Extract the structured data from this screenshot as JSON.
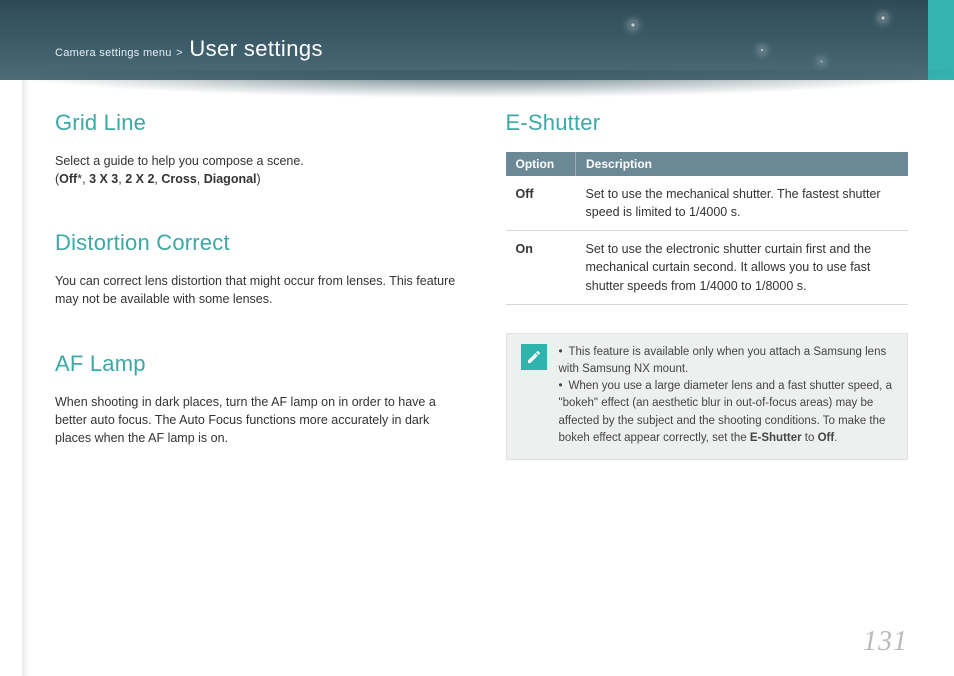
{
  "header": {
    "breadcrumb": "Camera settings menu",
    "separator": ">",
    "title": "User settings"
  },
  "left": {
    "grid": {
      "heading": "Grid Line",
      "text": "Select a guide to help you compose a scene.",
      "options_prefix": "(",
      "opt1": "Off",
      "star": "*",
      "sep": ", ",
      "opt2": "3 X 3",
      "opt3": "2 X 2",
      "opt4": "Cross",
      "opt5": "Diagonal",
      "options_suffix": ")"
    },
    "distortion": {
      "heading": "Distortion Correct",
      "text": "You can correct lens distortion that might occur from lenses. This feature may not be available with some lenses."
    },
    "aflamp": {
      "heading": "AF Lamp",
      "text": "When shooting in dark places, turn the AF lamp on in order to have a better auto focus. The Auto Focus functions more accurately in dark places when the AF lamp is on."
    }
  },
  "right": {
    "eshutter": {
      "heading": "E-Shutter",
      "th_option": "Option",
      "th_desc": "Description",
      "rows": [
        {
          "option": "Off",
          "desc": "Set to use the mechanical shutter. The fastest shutter speed is limited to 1/4000 s."
        },
        {
          "option": "On",
          "desc": "Set to use the electronic shutter curtain first and the mechanical curtain second. It allows you to use fast shutter speeds from 1/4000 to 1/8000 s."
        }
      ]
    },
    "note": {
      "item1": "This feature is available only when you attach a Samsung lens with Samsung NX mount.",
      "item2a": "When you use a large diameter lens and a fast shutter speed, a \"bokeh\" effect (an aesthetic blur in out-of-focus areas) may be affected by the subject and the shooting conditions. To make the bokeh effect appear correctly, set the ",
      "item2b": "E-Shutter",
      "item2c": " to ",
      "item2d": "Off",
      "item2e": "."
    }
  },
  "page_number": "131"
}
